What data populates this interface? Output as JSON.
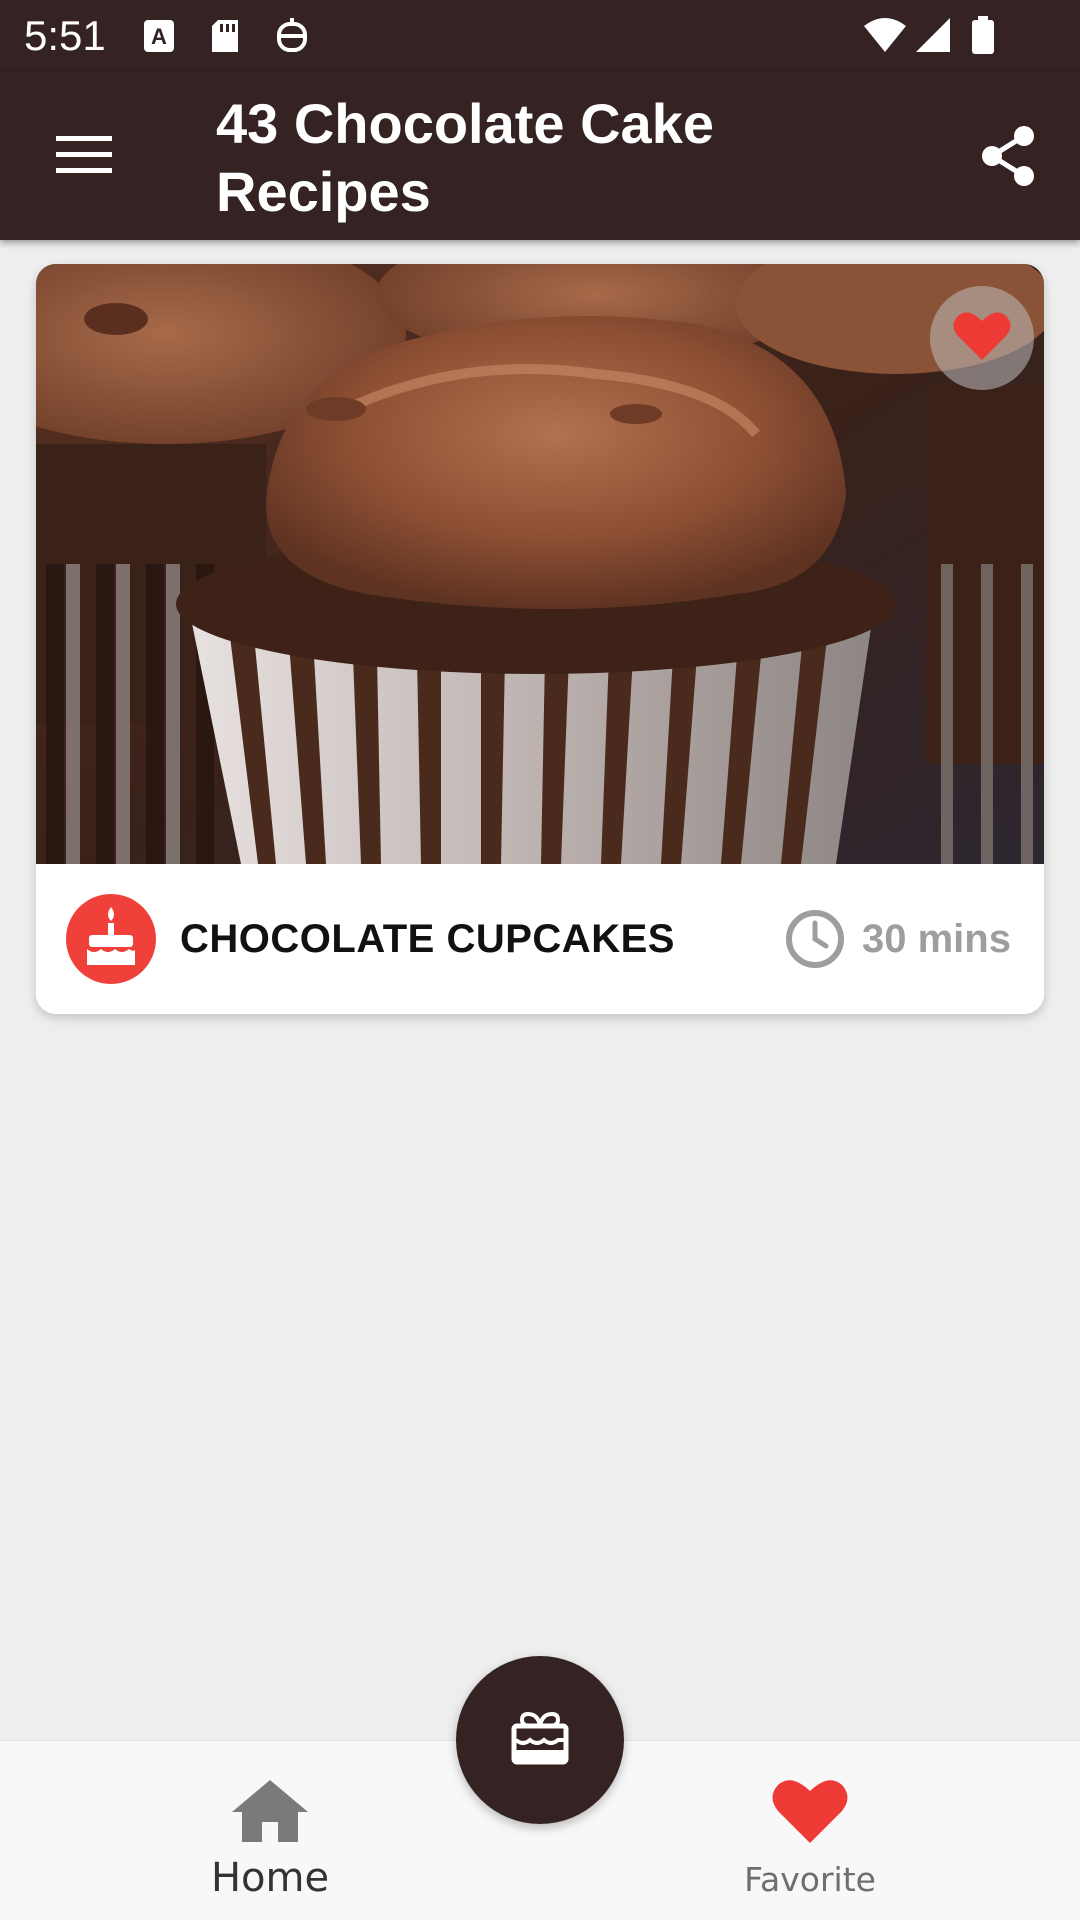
{
  "status_bar": {
    "time": "5:51",
    "left_icons": [
      "text-badge-icon",
      "sd-card-icon",
      "robot-icon"
    ],
    "right_icons": [
      "wifi-icon",
      "signal-icon",
      "battery-icon"
    ]
  },
  "app_bar": {
    "title": "43 Chocolate Cake Recipes",
    "menu_icon": "hamburger-menu-icon",
    "share_icon": "share-icon"
  },
  "recipes": [
    {
      "name": "CHOCOLATE CUPCAKES",
      "time": "30 mins",
      "favorited": true,
      "image_subject": "chocolate cupcake with chocolate frosting",
      "category_icon": "birthday-cake-icon"
    }
  ],
  "fab": {
    "icon": "cake-gift-icon"
  },
  "bottom_nav": {
    "items": [
      {
        "label": "Home",
        "icon": "home-icon",
        "selected": true
      },
      {
        "label": "Favorite",
        "icon": "heart-icon",
        "selected": false
      }
    ]
  },
  "colors": {
    "primary": "#352222",
    "accent_red": "#f0403a",
    "heart_red": "#ee3a35",
    "background": "#eeeeee",
    "muted_text": "#9e9e9e"
  }
}
